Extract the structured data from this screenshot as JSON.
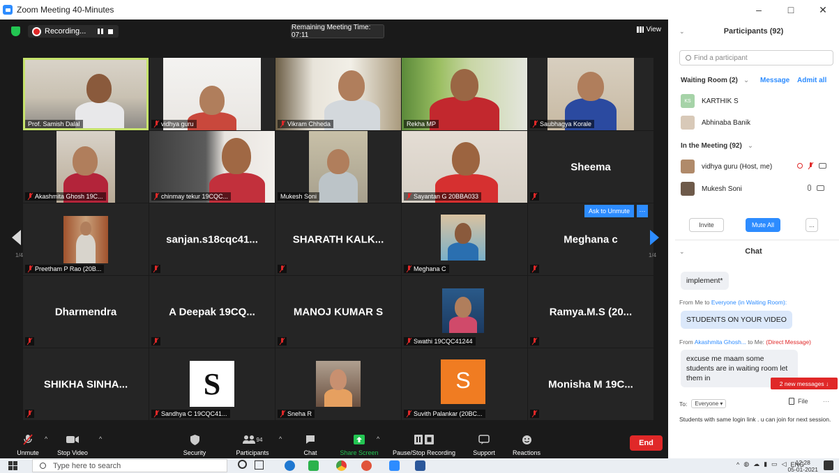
{
  "window": {
    "title": "Zoom Meeting 40-Minutes",
    "min": "–",
    "max": "□",
    "close": "✕"
  },
  "meeting": {
    "recording_label": "Recording...",
    "remaining_time": "Remaining Meeting Time: 07:11",
    "view_label": "View",
    "page_left": "1/4",
    "page_right": "1/4",
    "ask_to_unmute": "Ask to Unmute",
    "ask_more": "···"
  },
  "tiles": [
    {
      "label": "Prof. Samish Dalal",
      "muted": false
    },
    {
      "label": "vidhya guru",
      "muted": true
    },
    {
      "label": "Vikram Chheda",
      "muted": true
    },
    {
      "label": "Rekha MP",
      "muted": false
    },
    {
      "label": "Saubhagya Korale",
      "muted": true
    },
    {
      "label": "Akashmita Ghosh 19C...",
      "muted": true
    },
    {
      "label": "chinmay tekur 19CQC...",
      "muted": true
    },
    {
      "label": "Mukesh Soni",
      "muted": false
    },
    {
      "label": "Sayantan G 20BBA033",
      "muted": true
    },
    {
      "name": "Sheema",
      "muted": true
    },
    {
      "label": "Preetham P Rao (20B...",
      "muted": true
    },
    {
      "name": "sanjan.s18cqc41...",
      "muted": true
    },
    {
      "name": "SHARATH  KALK...",
      "muted": true
    },
    {
      "label": "Meghana C",
      "muted": true
    },
    {
      "name": "Meghana c",
      "muted": true
    },
    {
      "name": "Dharmendra",
      "muted": true
    },
    {
      "name": "A Deepak 19CQ...",
      "muted": true
    },
    {
      "name": "MANOJ KUMAR S",
      "muted": true
    },
    {
      "label": "Swathi 19CQC41244",
      "muted": true
    },
    {
      "name": "Ramya.M.S   (20...",
      "muted": true
    },
    {
      "name": "SHIKHA SINHA...",
      "muted": true
    },
    {
      "label": "Sandhya C 19CQC41...",
      "muted": true
    },
    {
      "label": "Sneha R",
      "muted": true
    },
    {
      "label": "Suvith Palankar (20BC...",
      "muted": true,
      "avatar_letter": "S"
    },
    {
      "name": "Monisha M 19C...",
      "muted": true
    }
  ],
  "toolbar": {
    "unmute": "Unmute",
    "stop_video": "Stop Video",
    "security": "Security",
    "participants": "Participants",
    "participants_count": "94",
    "chat": "Chat",
    "share_screen": "Share Screen",
    "pause_stop_recording": "Pause/Stop Recording",
    "support": "Support",
    "reactions": "Reactions",
    "end": "End",
    "share_color": "#23c552",
    "end_color": "#e02828"
  },
  "participants_panel": {
    "title": "Participants (92)",
    "search_placeholder": "Find a participant",
    "waiting_room_title": "Waiting Room (2)",
    "message_link": "Message",
    "admit_all_link": "Admit all",
    "waiting": [
      {
        "name": "KARTHIK S",
        "initials": "KS"
      },
      {
        "name": "Abhinaba Banik",
        "initials": ""
      }
    ],
    "in_meeting_title": "In the Meeting (92)",
    "in_meeting": [
      {
        "name": "vidhya guru (Host, me)"
      },
      {
        "name": "Mukesh Soni"
      }
    ],
    "invite": "Invite",
    "mute_all": "Mute All",
    "more": "..."
  },
  "chat_panel": {
    "title": "Chat",
    "messages": [
      {
        "text": "implement*"
      },
      {
        "from_prefix": "From Me to",
        "from_target": "Everyone (in Waiting Room):",
        "text": "STUDENTS ON YOUR VIDEO"
      },
      {
        "from_prefix": "From",
        "from_target": "Akashmita Ghosh...",
        "from_suffix": "to Me:",
        "direct": "(Direct Message)",
        "text": "excuse me maam some students are in waiting room let them in"
      }
    ],
    "new_messages": "2 new messages ↓",
    "to_label": "To:",
    "to_value": "Everyone ▾",
    "file_label": "File",
    "more": "···",
    "draft": "Students with same login link . u can join for next session."
  },
  "taskbar": {
    "search_placeholder": "Type here to search",
    "tray_text": "ENG",
    "time": "12:28",
    "date": "05-01-2021"
  }
}
